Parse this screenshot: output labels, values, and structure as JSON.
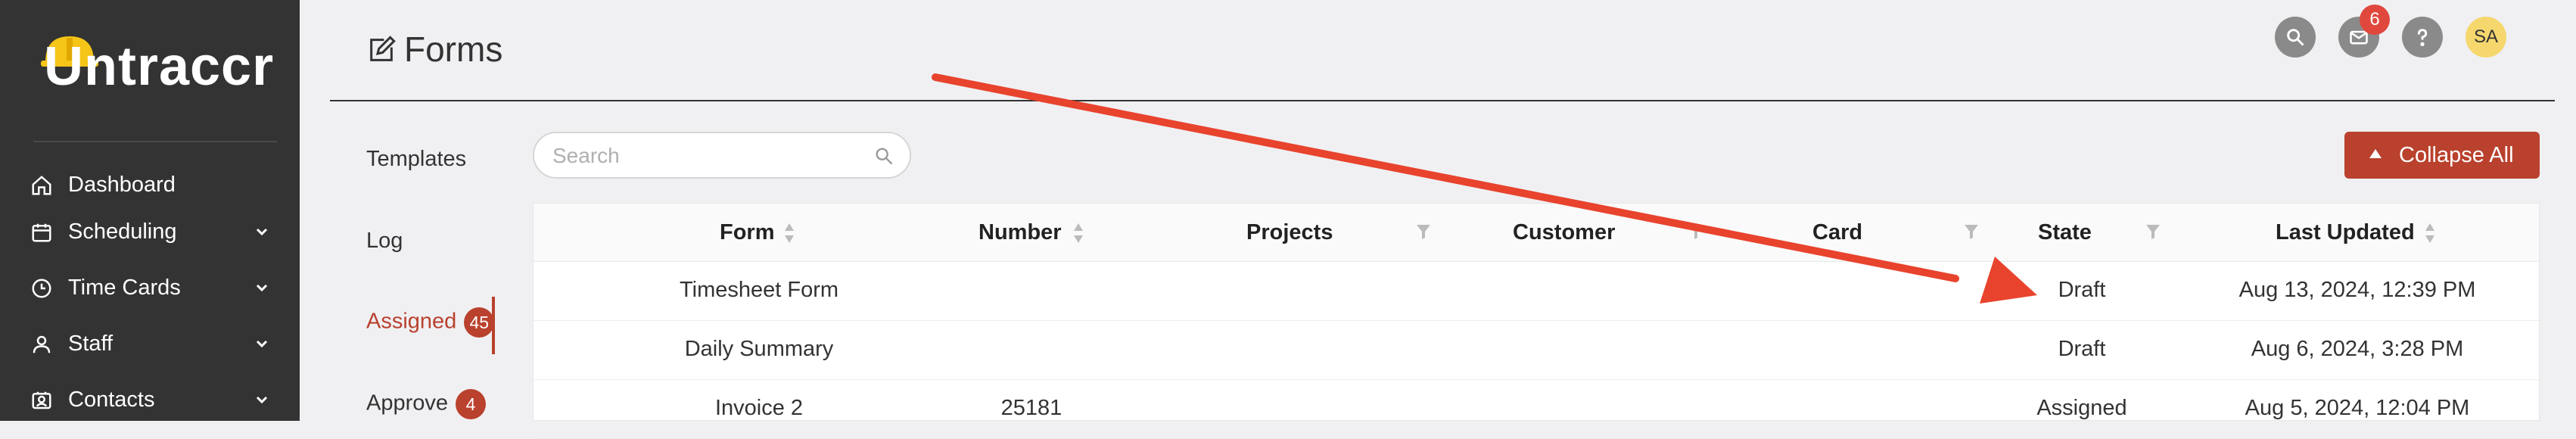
{
  "app": {
    "logo_text": "Untraccr"
  },
  "sidebar": {
    "items": [
      {
        "label": "Dashboard",
        "icon": "home-icon",
        "has_chevron": false
      },
      {
        "label": "Scheduling",
        "icon": "calendar-icon",
        "has_chevron": true
      },
      {
        "label": "Time Cards",
        "icon": "clock-icon",
        "has_chevron": true
      },
      {
        "label": "Staff",
        "icon": "user-icon",
        "has_chevron": true
      },
      {
        "label": "Contacts",
        "icon": "contacts-icon",
        "has_chevron": true
      }
    ]
  },
  "header": {
    "title": "Forms",
    "notification_count": "6",
    "avatar_initials": "SA"
  },
  "subnav": {
    "templates": "Templates",
    "log": "Log",
    "assigned": "Assigned",
    "assigned_count": "45",
    "approve": "Approve",
    "approve_count": "4"
  },
  "search": {
    "placeholder": "Search"
  },
  "collapse_button": {
    "label": "Collapse All"
  },
  "table": {
    "columns": [
      "Form",
      "Number",
      "Projects",
      "Customer",
      "Card",
      "State",
      "Last Updated"
    ],
    "rows": [
      {
        "form": "Timesheet Form",
        "number": "",
        "projects": "",
        "customer": "",
        "card": "",
        "state": "Draft",
        "last_updated": "Aug 13, 2024, 12:39 PM"
      },
      {
        "form": "Daily Summary",
        "number": "",
        "projects": "",
        "customer": "",
        "card": "",
        "state": "Draft",
        "last_updated": "Aug 6, 2024, 3:28 PM"
      },
      {
        "form": "Invoice 2",
        "number": "25181",
        "projects": "",
        "customer": "",
        "card": "",
        "state": "Assigned",
        "last_updated": "Aug 5, 2024, 12:04 PM"
      }
    ]
  },
  "colors": {
    "sidebar_bg": "#333333",
    "accent": "#b9412d",
    "annotation_arrow": "#e8432d",
    "badge": "#e0483e"
  }
}
